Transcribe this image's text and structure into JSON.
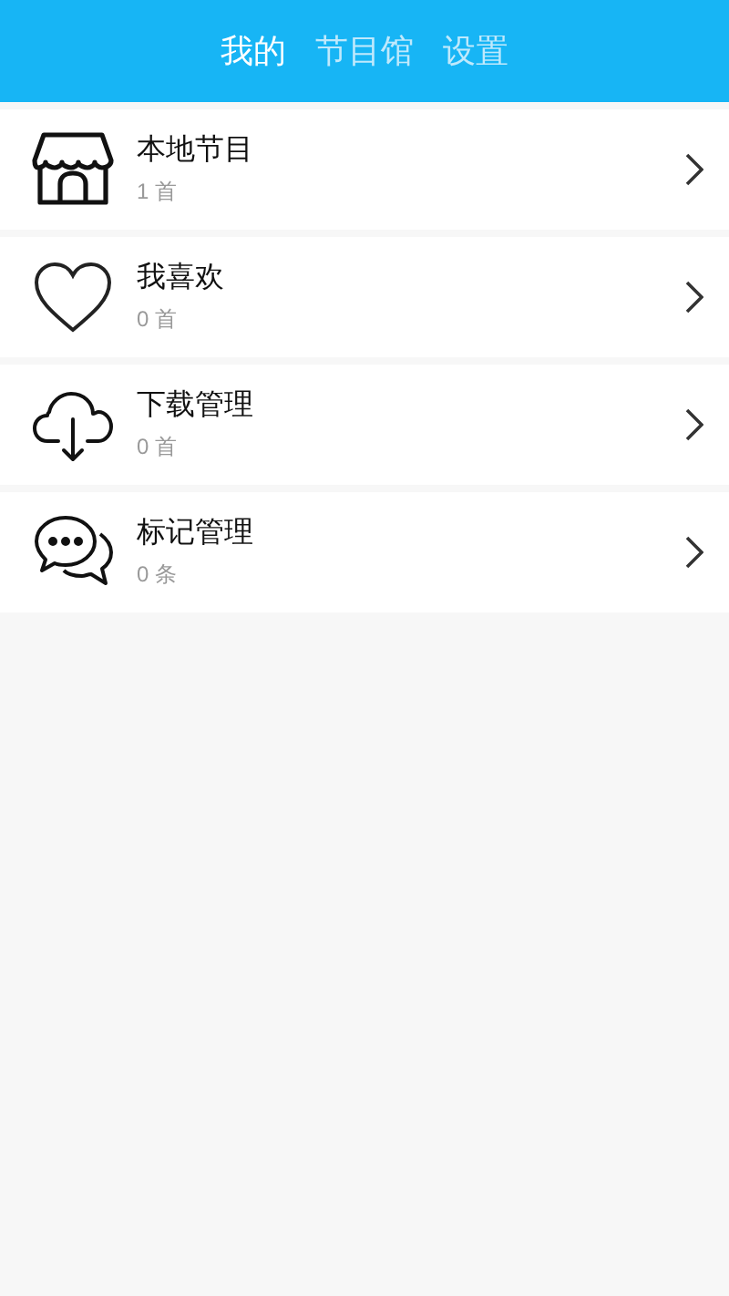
{
  "tabs": [
    {
      "label": "我的",
      "selected": true
    },
    {
      "label": "节目馆",
      "selected": false
    },
    {
      "label": "设置",
      "selected": false
    }
  ],
  "items": [
    {
      "title": "本地节目",
      "count": "1 首"
    },
    {
      "title": "我喜欢",
      "count": "0 首"
    },
    {
      "title": "下载管理",
      "count": "0 首"
    },
    {
      "title": "标记管理",
      "count": "0 条"
    }
  ]
}
